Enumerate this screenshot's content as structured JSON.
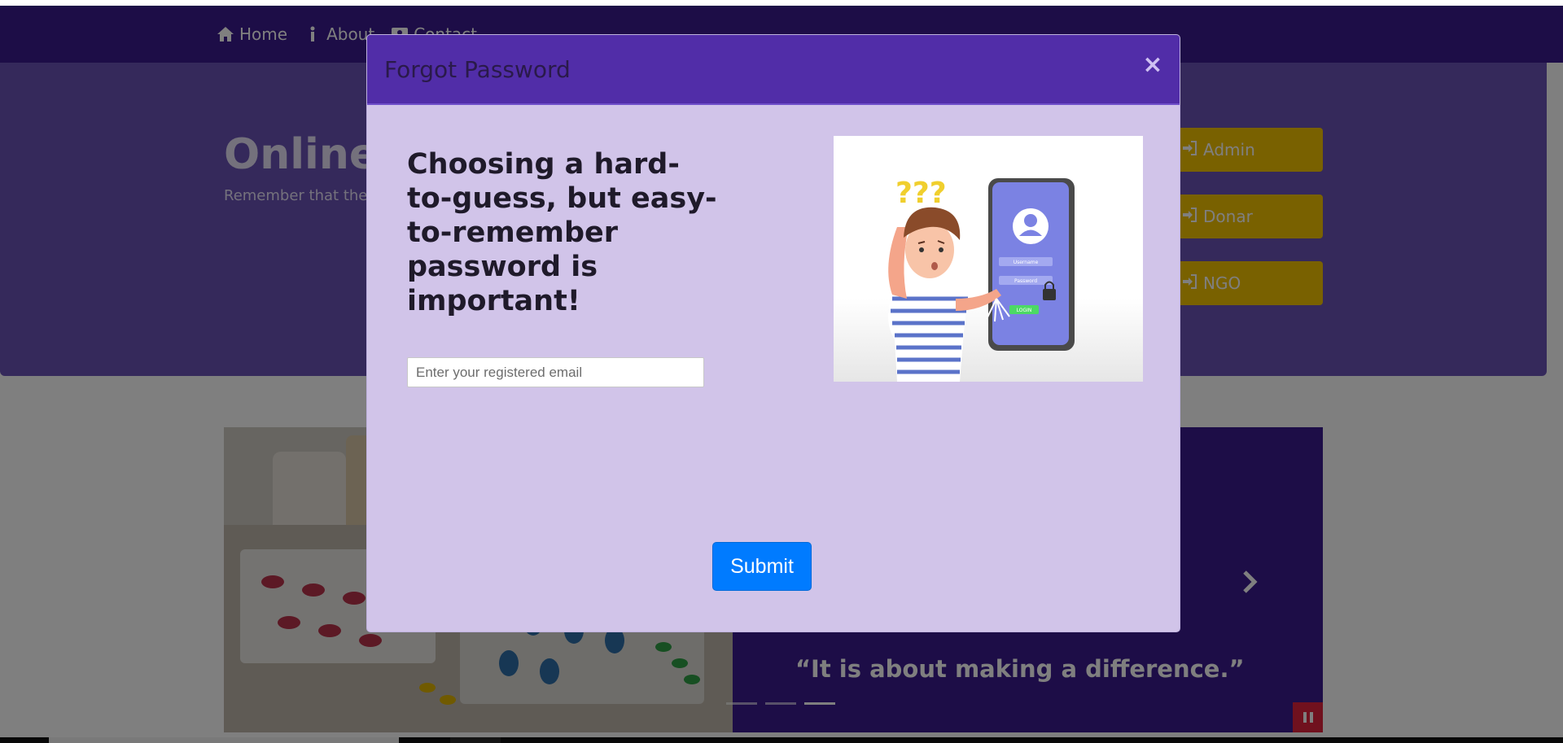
{
  "navbar": {
    "items": [
      {
        "label": "Home",
        "icon": "home-icon"
      },
      {
        "label": "About",
        "icon": "info-icon"
      },
      {
        "label": "Contact",
        "icon": "contact-icon"
      }
    ]
  },
  "hero": {
    "title": "Online U",
    "subtitle": "Remember that the",
    "buttons": [
      {
        "label": "Admin",
        "icon": "sign-in-icon"
      },
      {
        "label": "Donar",
        "icon": "sign-in-icon"
      },
      {
        "label": "NGO",
        "icon": "sign-in-icon"
      }
    ]
  },
  "carousel": {
    "quote": "“It is about making a difference.”",
    "indicator_count": 3,
    "active_indicator": 3
  },
  "modal": {
    "title": "Forgot Password",
    "close_label": "×",
    "heading": "Choosing a hard-to-guess, but easy-to-remember password is important!",
    "email_placeholder": "Enter your registered email",
    "email_value": "",
    "submit_label": "Submit",
    "illustration": {
      "question_marks": "???",
      "username_label": "Username",
      "password_label": "Password",
      "login_label": "LOGIN"
    }
  },
  "colors": {
    "navbar": "#3b1b8f",
    "hero": "#6a52b7",
    "modal_header": "#512da8",
    "modal_body": "#d1c4e9",
    "login_buttons": "#f3c300",
    "submit_button": "#007bff",
    "pause_button": "#e0223d"
  }
}
